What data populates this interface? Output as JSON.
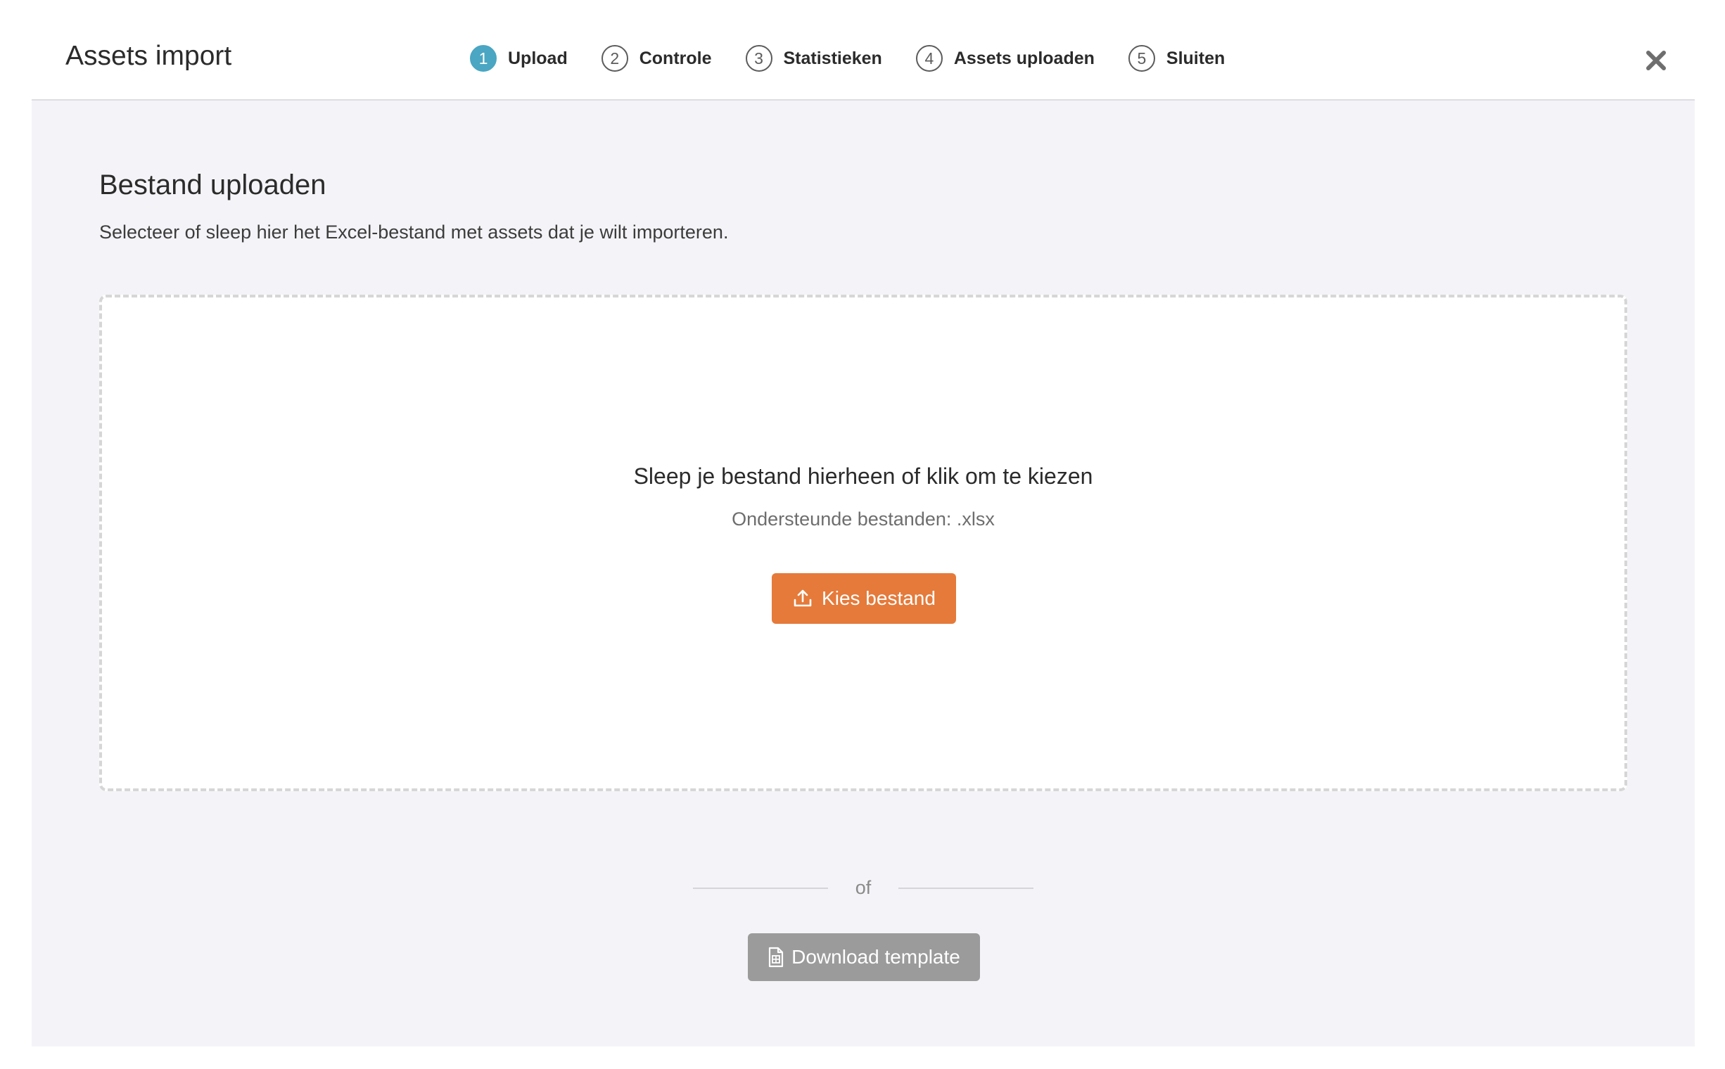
{
  "modal": {
    "title": "Assets import",
    "close_icon": "close-icon"
  },
  "steps": [
    {
      "number": "1",
      "label": "Upload",
      "active": true
    },
    {
      "number": "2",
      "label": "Controle",
      "active": false
    },
    {
      "number": "3",
      "label": "Statistieken",
      "active": false
    },
    {
      "number": "4",
      "label": "Assets uploaden",
      "active": false
    },
    {
      "number": "5",
      "label": "Sluiten",
      "active": false
    }
  ],
  "upload": {
    "title": "Bestand uploaden",
    "description": "Selecteer of sleep hier het Excel-bestand met assets dat je wilt importeren."
  },
  "dropzone": {
    "title": "Sleep je bestand hierheen of klik om te kiezen",
    "supported": "Ondersteunde bestanden: .xlsx",
    "button_label": "Kies bestand",
    "button_icon": "upload-icon"
  },
  "divider_text": "of",
  "download": {
    "label": "Download template",
    "icon": "spreadsheet-file-icon"
  },
  "colors": {
    "accent": "#4aa6c2",
    "primary_button": "#e57a3a",
    "secondary_button": "#9b9b9b",
    "body_background": "#f4f4f8"
  }
}
